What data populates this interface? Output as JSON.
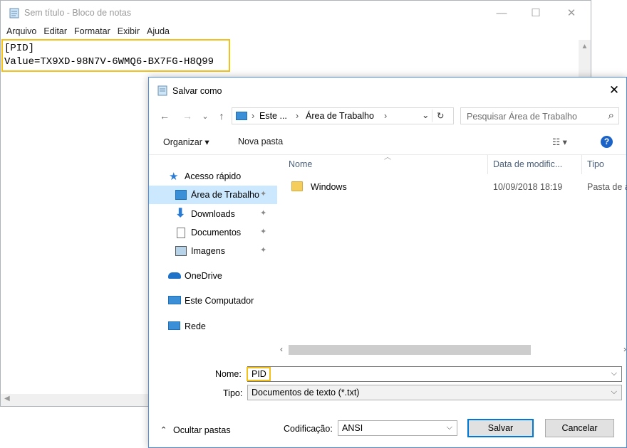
{
  "notepad": {
    "title": "Sem título - Bloco de notas",
    "menu": [
      "Arquivo",
      "Editar",
      "Formatar",
      "Exibir",
      "Ajuda"
    ],
    "lines": [
      "[PID]",
      "Value=TX9XD-98N7V-6WMQ6-BX7FG-H8Q99"
    ],
    "controls": {
      "minimize": "—",
      "maximize": "☐",
      "close": "✕"
    }
  },
  "dialog": {
    "title": "Salvar como",
    "close": "✕",
    "nav": {
      "back": "←",
      "forward": "→",
      "recent": "⌄",
      "up": "↑"
    },
    "address": {
      "seg1": "Este ...",
      "seg2": "Área de Trabalho",
      "sep": "›",
      "refresh": "↻",
      "dropdown": "⌄"
    },
    "search": {
      "placeholder": "Pesquisar Área de Trabalho",
      "icon": "⌕"
    },
    "toolbar": {
      "organize": "Organizar ▾",
      "new_folder": "Nova pasta",
      "view": "☷ ▾",
      "help": "?"
    },
    "nav_pane": [
      {
        "label": "Acesso rápido",
        "icon": "star-icon"
      },
      {
        "label": "Área de Trabalho",
        "icon": "desktop-icon",
        "pinned": true,
        "selected": true
      },
      {
        "label": "Downloads",
        "icon": "download-icon",
        "pinned": true
      },
      {
        "label": "Documentos",
        "icon": "document-icon",
        "pinned": true
      },
      {
        "label": "Imagens",
        "icon": "pictures-icon",
        "pinned": true
      },
      {
        "label": "OneDrive",
        "icon": "cloud-icon"
      },
      {
        "label": "Este Computador",
        "icon": "computer-icon"
      },
      {
        "label": "Rede",
        "icon": "network-icon"
      }
    ],
    "columns": {
      "name": "Nome",
      "date": "Data de modific...",
      "type": "Tipo"
    },
    "files": [
      {
        "name": "Windows",
        "date": "10/09/2018 18:19",
        "type": "Pasta de a"
      }
    ],
    "hscroll": {
      "left": "‹",
      "right": "›"
    },
    "name_label": "Nome:",
    "name_value": "PID",
    "type_label": "Tipo:",
    "type_value": "Documentos de texto (*.txt)",
    "hide_folders": "Ocultar pastas",
    "encoding_label": "Codificação:",
    "encoding_value": "ANSI",
    "save_button": "Salvar",
    "cancel_button": "Cancelar",
    "pin_glyph": "📌"
  },
  "colors": {
    "highlight": "#f2c21b",
    "accent": "#0078d7",
    "selected": "#cce8ff"
  }
}
